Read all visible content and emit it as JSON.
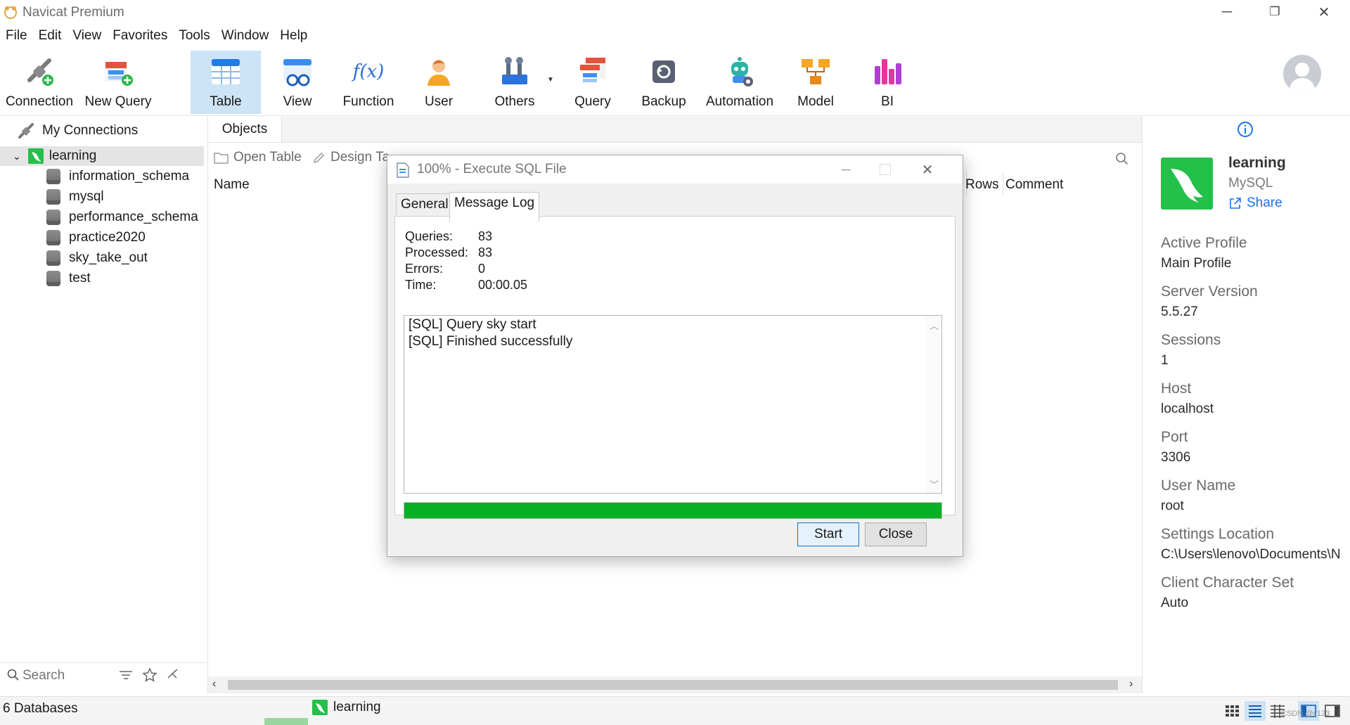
{
  "window": {
    "title": "Navicat Premium",
    "controls": {
      "minimize": "─",
      "restore": "❐",
      "close": "✕"
    }
  },
  "menu": [
    "File",
    "Edit",
    "View",
    "Favorites",
    "Tools",
    "Window",
    "Help"
  ],
  "toolbar": [
    {
      "label": "Connection",
      "icon": "connection-icon"
    },
    {
      "label": "New Query",
      "icon": "new-query-icon"
    },
    {
      "label": "Table",
      "icon": "table-icon",
      "active": true
    },
    {
      "label": "View",
      "icon": "view-icon"
    },
    {
      "label": "Function",
      "icon": "function-icon",
      "glyph": "f(x)"
    },
    {
      "label": "User",
      "icon": "user-icon"
    },
    {
      "label": "Others",
      "icon": "others-icon"
    },
    {
      "label": "Query",
      "icon": "query-icon"
    },
    {
      "label": "Backup",
      "icon": "backup-icon"
    },
    {
      "label": "Automation",
      "icon": "automation-icon"
    },
    {
      "label": "Model",
      "icon": "model-icon"
    },
    {
      "label": "BI",
      "icon": "bi-icon"
    }
  ],
  "sidebar": {
    "header": "My Connections",
    "connection": "learning",
    "databases": [
      "information_schema",
      "mysql",
      "performance_schema",
      "practice2020",
      "sky_take_out",
      "test"
    ],
    "search_placeholder": "Search"
  },
  "objects": {
    "tab": "Objects",
    "actions": [
      "Open Table",
      "Design Ta"
    ],
    "columns": {
      "name": "Name",
      "rows": "Rows",
      "comment": "Comment"
    }
  },
  "info": {
    "connection_name": "learning",
    "db_type": "MySQL",
    "share": "Share",
    "fields": [
      {
        "label": "Active Profile",
        "value": "Main Profile"
      },
      {
        "label": "Server Version",
        "value": "5.5.27"
      },
      {
        "label": "Sessions",
        "value": "1"
      },
      {
        "label": "Host",
        "value": "localhost"
      },
      {
        "label": "Port",
        "value": "3306"
      },
      {
        "label": "User Name",
        "value": "root"
      },
      {
        "label": "Settings Location",
        "value": "C:\\Users\\lenovo\\Documents\\N"
      },
      {
        "label": "Client Character Set",
        "value": "Auto"
      }
    ]
  },
  "dialog": {
    "title": "100% - Execute SQL File",
    "tabs": [
      "General",
      "Message Log"
    ],
    "selected_tab": "Message Log",
    "stats": [
      {
        "label": "Queries:",
        "value": "83"
      },
      {
        "label": "Processed:",
        "value": "83"
      },
      {
        "label": "Errors:",
        "value": "0"
      },
      {
        "label": "Time:",
        "value": "00:00.05"
      }
    ],
    "log": [
      "[SQL] Query sky start",
      "[SQL] Finished successfully"
    ],
    "progress": 1.0,
    "buttons": {
      "start": "Start",
      "close": "Close"
    }
  },
  "statusbar": {
    "count": "6 Databases",
    "connection": "learning",
    "watermark": "CSDN @y123"
  },
  "colors": {
    "accent": "#0078d7",
    "progress": "#06b025",
    "mysql_green": "#23c04a",
    "active_tool": "#cde3f6"
  }
}
